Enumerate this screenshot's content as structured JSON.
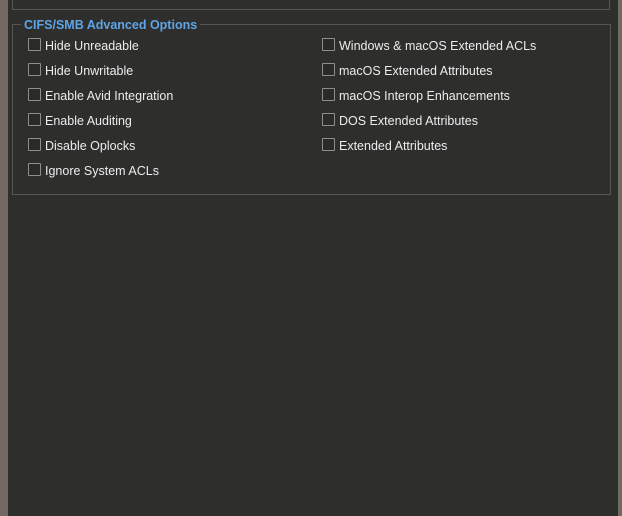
{
  "section": {
    "legend": "CIFS/SMB Advanced Options"
  },
  "left_options": [
    {
      "label": "Hide Unreadable",
      "checked": false
    },
    {
      "label": "Hide Unwritable",
      "checked": false
    },
    {
      "label": "Enable Avid Integration",
      "checked": false
    },
    {
      "label": "Enable Auditing",
      "checked": false
    },
    {
      "label": "Disable Oplocks",
      "checked": false
    },
    {
      "label": "Ignore System ACLs",
      "checked": false
    }
  ],
  "right_options": [
    {
      "label": "Windows & macOS Extended ACLs",
      "checked": false
    },
    {
      "label": "macOS Extended Attributes",
      "checked": false
    },
    {
      "label": "macOS Interop Enhancements",
      "checked": false
    },
    {
      "label": "DOS Extended Attributes",
      "checked": false
    },
    {
      "label": "Extended Attributes",
      "checked": false
    }
  ],
  "colors": {
    "legend": "#5ea4e6",
    "panel_bg": "#2e2f2d",
    "outer_bg": "#726a62",
    "text": "#ececec"
  }
}
